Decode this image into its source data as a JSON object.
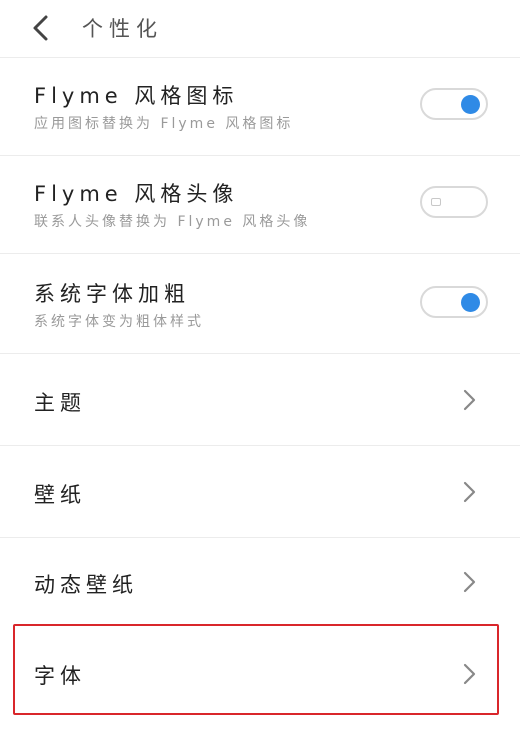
{
  "header": {
    "title": "个性化",
    "back_icon": "chevron-left-icon"
  },
  "settings": [
    {
      "title": "Flyme 风格图标",
      "subtitle": "应用图标替换为 Flyme 风格图标",
      "control": "toggle",
      "enabled": true
    },
    {
      "title": "Flyme 风格头像",
      "subtitle": "联系人头像替换为 Flyme 风格头像",
      "control": "toggle",
      "enabled": false
    },
    {
      "title": "系统字体加粗",
      "subtitle": "系统字体变为粗体样式",
      "control": "toggle",
      "enabled": true
    },
    {
      "title": "主题",
      "control": "chevron"
    },
    {
      "title": "壁纸",
      "control": "chevron"
    },
    {
      "title": "动态壁纸",
      "control": "chevron"
    },
    {
      "title": "字体",
      "control": "chevron",
      "highlighted": true
    }
  ],
  "colors": {
    "accent": "#2f8ae6",
    "highlight": "#d9262b",
    "divider": "#ececec"
  }
}
